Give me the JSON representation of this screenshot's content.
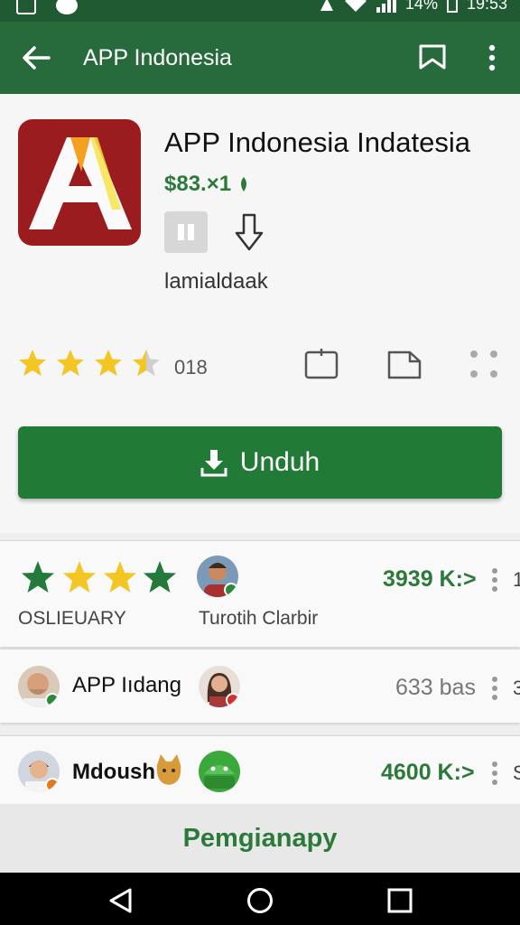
{
  "status_bar": {
    "battery": "14%",
    "time": "19:53"
  },
  "app_bar": {
    "title": "APP Indonesia"
  },
  "app": {
    "name": "APP Indonesia Indatesia",
    "price": "$83.×1",
    "developer": "lamialdaak",
    "rating_stars": 3.5,
    "rating_count": "018",
    "install_label": "Unduh",
    "brand_color": "#217a36",
    "icon_color": "#9b1c1f"
  },
  "reviews": [
    {
      "title": "OSLIEUARY",
      "reviewer": "Turotih Clarbir",
      "value": "3939 K:>",
      "edge": "1"
    },
    {
      "title": "APP Iıdang",
      "value": "633 bas",
      "edge": "3"
    },
    {
      "title": "Mdoush",
      "value": "4600 K:>",
      "edge": "S"
    }
  ],
  "bottom": {
    "label": "Pemgianapy"
  }
}
